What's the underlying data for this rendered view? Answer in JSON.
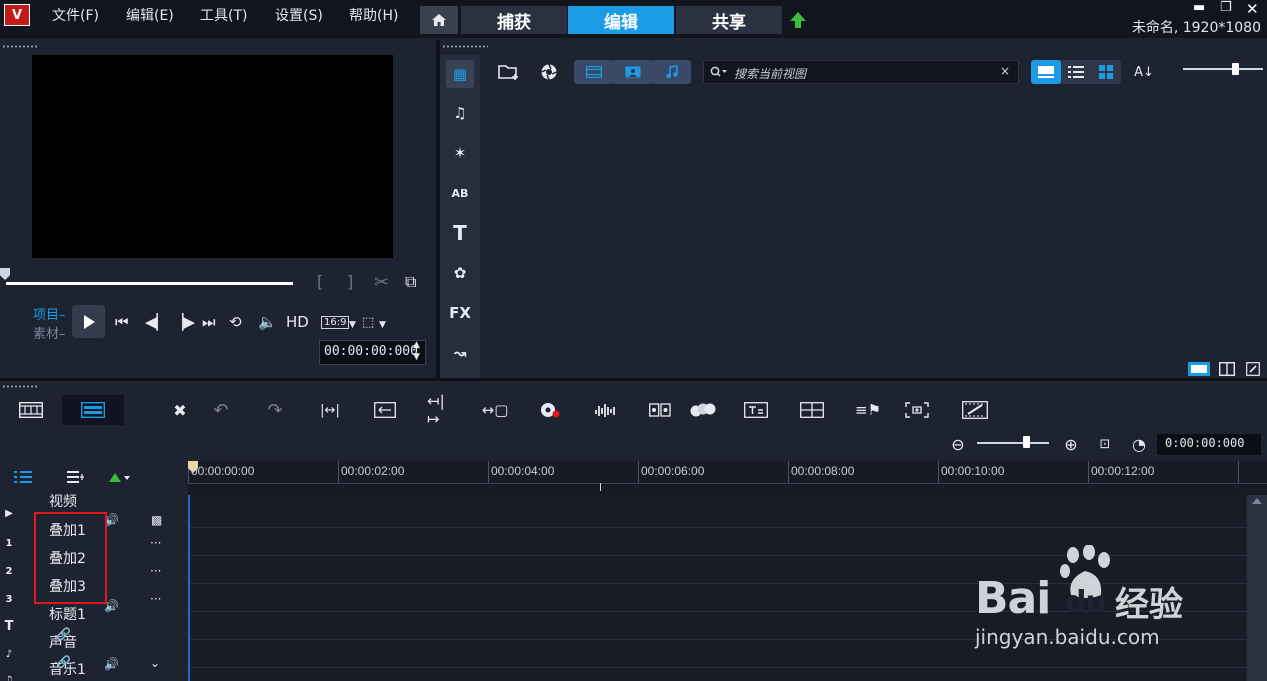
{
  "app": {
    "logo_text": "V",
    "project_info": "未命名, 1920*1080"
  },
  "menu": [
    "文件(F)",
    "编辑(E)",
    "工具(T)",
    "设置(S)",
    "帮助(H)"
  ],
  "workspace_tabs": [
    {
      "label": "捕获",
      "active": false
    },
    {
      "label": "编辑",
      "active": true
    },
    {
      "label": "共享",
      "active": false
    }
  ],
  "player": {
    "mode_project": "项目",
    "mode_clip": "素材",
    "timecode": "00:00:00:000",
    "hd_label": "HD",
    "aspect_label": "16:9",
    "mark_in": "[",
    "mark_out": "]"
  },
  "library": {
    "search_placeholder": "搜索当前视图",
    "sidebar_items": [
      {
        "name": "media-icon",
        "glyph": "▦",
        "active": true
      },
      {
        "name": "audio-icon",
        "glyph": "♫",
        "active": false
      },
      {
        "name": "instant-project-icon",
        "glyph": "✶",
        "active": false
      },
      {
        "name": "transition-icon",
        "glyph": "AB",
        "active": false
      },
      {
        "name": "title-icon",
        "glyph": "T",
        "active": false
      },
      {
        "name": "graphics-icon",
        "glyph": "✿",
        "active": false
      },
      {
        "name": "filter-icon",
        "glyph": "FX",
        "active": false
      },
      {
        "name": "path-icon",
        "glyph": "↝",
        "active": false
      }
    ]
  },
  "timeline": {
    "timecode": "0:00:00:000",
    "ruler_labels": [
      "00:00:00:00",
      "00:00:02:00",
      "00:00:04:00",
      "00:00:06:00",
      "00:00:08:00",
      "00:00:10:00",
      "00:00:12:00"
    ],
    "tracks": [
      {
        "label": "视频",
        "icon": "video-track-icon",
        "icon_text": "▶"
      },
      {
        "label": "叠加1",
        "icon": "overlay-track-1-icon",
        "icon_text": "1"
      },
      {
        "label": "叠加2",
        "icon": "overlay-track-2-icon",
        "icon_text": "2"
      },
      {
        "label": "叠加3",
        "icon": "overlay-track-3-icon",
        "icon_text": "3"
      },
      {
        "label": "标题1",
        "icon": "title-track-icon",
        "icon_text": "T"
      },
      {
        "label": "声音",
        "icon": "voice-track-icon",
        "icon_text": "♪"
      },
      {
        "label": "音乐1",
        "icon": "music-track-icon",
        "icon_text": "♫"
      }
    ]
  },
  "watermark": {
    "brand_left": "Bai",
    "brand_right": "du",
    "brand_cn": "经验",
    "url": "jingyan.baidu.com"
  }
}
